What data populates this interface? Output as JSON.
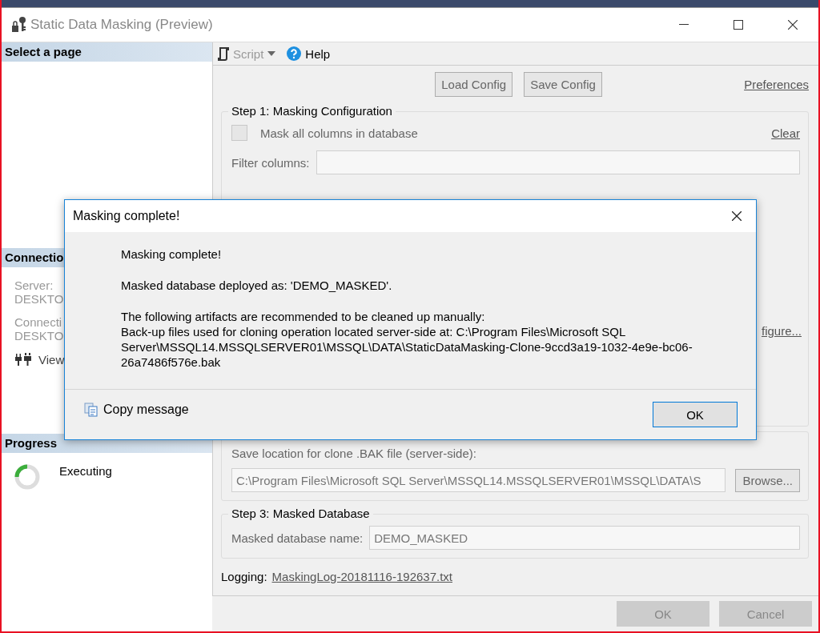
{
  "window": {
    "title": "Static Data Masking (Preview)"
  },
  "sidebar": {
    "select_page_header": "Select a page",
    "connection": {
      "header": "Connectio",
      "server_label": "Server:",
      "server_value": "DESKTO",
      "connection_label": "Connecti",
      "connection_value": "DESKTO",
      "view_link": "View"
    },
    "progress": {
      "header": "Progress",
      "status": "Executing"
    }
  },
  "toolbar": {
    "script": {
      "label": "Script",
      "disabled": true
    },
    "help": "Help"
  },
  "config_buttons": [
    "Load Config",
    "Save Config"
  ],
  "preferences_link": "Preferences",
  "step1": {
    "title": "Step 1: Masking Configuration",
    "mask_all": {
      "label": "Mask all columns in database",
      "checked": false
    },
    "clear_link": "Clear",
    "filter_label": "Filter columns:",
    "configure_link": "figure..."
  },
  "step2": {
    "save_location_label": "Save location for clone .BAK file (server-side):",
    "save_location_value": "C:\\Program Files\\Microsoft SQL Server\\MSSQL14.MSSQLSERVER01\\MSSQL\\DATA\\S",
    "browse_button": "Browse..."
  },
  "step3": {
    "title": "Step 3: Masked Database",
    "name_label": "Masked database name:",
    "name_value": "DEMO_MASKED"
  },
  "logging": {
    "label": "Logging:",
    "link": "MaskingLog-20181116-192637.txt"
  },
  "footer_buttons": [
    {
      "label": "OK",
      "disabled": true
    },
    {
      "label": "Cancel",
      "disabled": true
    }
  ],
  "dialog": {
    "title": "Masking complete!",
    "paragraphs": [
      [
        "Masking complete!"
      ],
      [
        "Masked database deployed as: 'DEMO_MASKED'."
      ],
      [
        "The following artifacts are recommended to be cleaned up manually:",
        "Back-up files used for cloning operation located server-side at: C:\\Program Files\\Microsoft SQL Server\\MSSQL14.MSSQLSERVER01\\MSSQL\\DATA\\StaticDataMasking-Clone-9ccd3a19-1032-4e9e-bc06-26a7486f576e.bak"
      ]
    ],
    "copy_message": "Copy message",
    "ok_button": "OK"
  }
}
